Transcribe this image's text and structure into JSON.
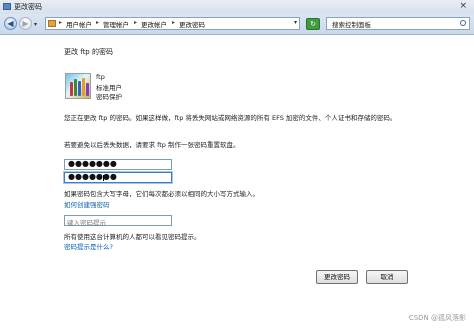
{
  "window": {
    "title": "更改密码"
  },
  "nav": {
    "breadcrumbs": [
      "用户帐户",
      "管理帐户",
      "更改帐户",
      "更改密码"
    ],
    "search_placeholder": "搜索控制面板",
    "back_glyph": "◀",
    "forward_glyph": "▶",
    "dropdown_glyph": "▾",
    "separator_glyph": "▸",
    "refresh_glyph": "↻"
  },
  "main": {
    "heading": "更改 ftp 的密码",
    "user": {
      "name": "ftp",
      "role": "标准用户",
      "protection": "密码保护"
    },
    "paragraph1": "您正在更改 ftp 的密码。如果这样做，ftp 将丢失网站或网络资源的所有 EFS 加密的文件、个人证书和存储的密码。",
    "paragraph2": "若要避免以后丢失数据，请要求 ftp 制作一张密码重置软盘。",
    "new_password_mask": "●●●●●●●",
    "confirm_password_mask": "●●●●●●●",
    "caps_note": "如果密码包含大写字母，它们每次都必须以相同的大小写方式输入。",
    "link_strong_password": "如何创建强密码",
    "hint_placeholder": "键入密码提示",
    "hint_note": "所有使用这台计算机的人都可以看见密码提示。",
    "link_hint": "密码提示是什么?",
    "btn_change": "更改密码",
    "btn_cancel": "取消"
  },
  "watermark": "CSDN @孤风落影",
  "colors": {
    "link": "#0b5fb3",
    "nav_bg": "#c9d8ec",
    "focus_border": "#3d7bc4"
  }
}
